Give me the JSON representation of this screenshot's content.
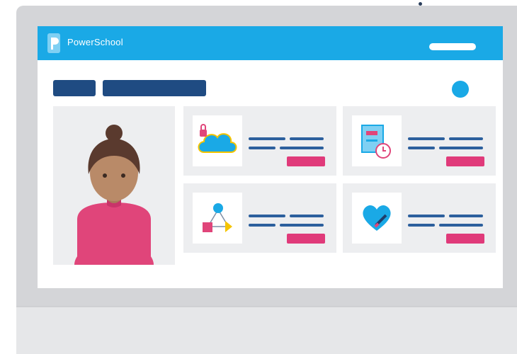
{
  "app": {
    "brand_name": "PowerSchool",
    "colors": {
      "topbar": "#1aa9e6",
      "nav": "#1f4b82",
      "badge": "#e03a7a",
      "panel": "#edeef0"
    }
  },
  "cards": [
    {
      "icon": "cloud-lock-icon"
    },
    {
      "icon": "calendar-clock-icon"
    },
    {
      "icon": "shapes-network-icon"
    },
    {
      "icon": "heart-pen-icon"
    }
  ]
}
